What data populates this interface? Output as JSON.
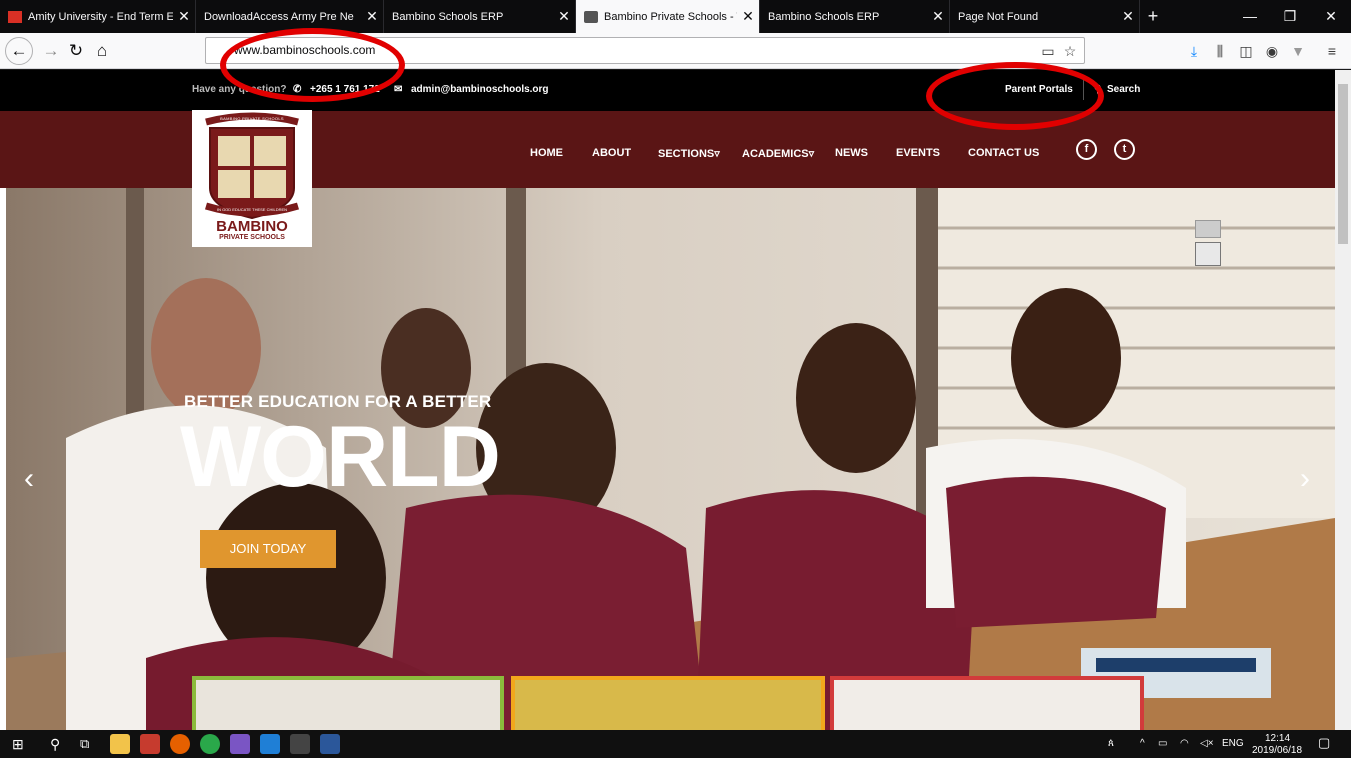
{
  "browser": {
    "tabs": [
      {
        "title": "Amity University - End Term Ex",
        "active": false
      },
      {
        "title": "DownloadAccess Army Pre Ne",
        "active": false
      },
      {
        "title": "Bambino Schools ERP",
        "active": false
      },
      {
        "title": "Bambino Private Schools - The",
        "active": true
      },
      {
        "title": "Bambino Schools ERP",
        "active": false
      },
      {
        "title": "Page Not Found",
        "active": false
      }
    ],
    "new_tab": "+",
    "url": "www.bambinoschools.com"
  },
  "site": {
    "topbar": {
      "question": "Have any question?",
      "phone": "+265 1 761 172",
      "email": "admin@bambinoschools.org",
      "parent_portals": "Parent Portals",
      "search": "Search"
    },
    "logo": {
      "arc_text": "BAMBINO PRIVATE SCHOOLS",
      "motto": "IN GOD EDUCATE THESE CHILDREN",
      "name": "BAMBINO",
      "sub": "PRIVATE SCHOOLS"
    },
    "nav": [
      "HOME",
      "ABOUT",
      "SECTIONS▿",
      "ACADEMICS▿",
      "NEWS",
      "EVENTS",
      "CONTACT US"
    ],
    "social": {
      "facebook": "f",
      "twitter": "t"
    },
    "hero": {
      "subtitle": "BETTER EDUCATION FOR A BETTER",
      "title": "WORLD",
      "cta": "JOIN TODAY"
    },
    "accent_colors": {
      "maroon": "#5a1515",
      "orange": "#e0962e",
      "green": "#8bbb3c",
      "yellow": "#f2a81c",
      "red": "#d23b3b"
    }
  },
  "taskbar": {
    "lang": "ENG",
    "time": "12:14",
    "date": "2019/06/18"
  }
}
